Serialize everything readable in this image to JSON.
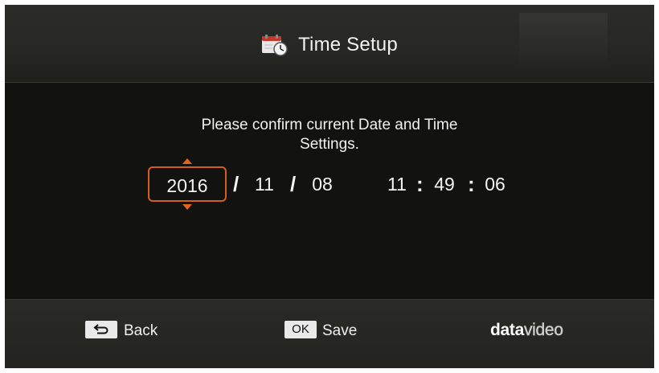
{
  "header": {
    "title": "Time Setup",
    "icon": "calendar-clock-icon"
  },
  "prompt": {
    "line1": "Please confirm current Date and Time",
    "line2": "Settings."
  },
  "datetime": {
    "year": "2016",
    "month": "11",
    "day": "08",
    "hour": "11",
    "minute": "49",
    "second": "06",
    "date_separator": "/",
    "time_separator": ":",
    "selected_field": "year"
  },
  "footer": {
    "back_key": "back-arrow-icon",
    "back_label": "Back",
    "ok_key": "OK",
    "save_label": "Save",
    "logo_bold": "data",
    "logo_light": "video"
  },
  "colors": {
    "accent": "#d35f1b",
    "background": "#121311",
    "bar": "#2a2a27"
  }
}
